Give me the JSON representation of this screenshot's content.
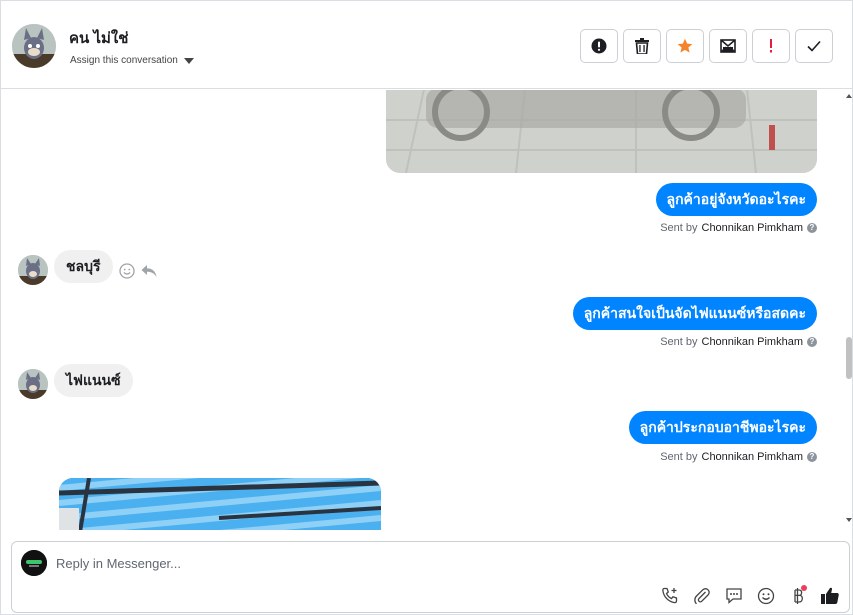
{
  "header": {
    "contact_name": "คน ไม่ใช่",
    "assign_label": "Assign this conversation",
    "actions": [
      {
        "name": "mark-spam",
        "icon": "exclamation-circle-icon"
      },
      {
        "name": "delete",
        "icon": "trash-icon"
      },
      {
        "name": "star",
        "icon": "star-icon",
        "color": "#f5832b"
      },
      {
        "name": "mark-unread",
        "icon": "envelope-icon"
      },
      {
        "name": "follow-up",
        "icon": "exclamation-icon",
        "color": "#e41e3f"
      },
      {
        "name": "mark-done",
        "icon": "check-icon"
      }
    ]
  },
  "messages": [
    {
      "direction": "out",
      "type": "image"
    },
    {
      "direction": "out",
      "text": "ลูกค้าอยู่จังหวัดอะไรคะ",
      "sent_by_prefix": "Sent by",
      "sender": "Chonnikan Pimkham"
    },
    {
      "direction": "in",
      "text": "ชลบุรี"
    },
    {
      "direction": "out",
      "text": "ลูกค้าสนใจเป็นจัดไฟแนนซ์หรือสดคะ",
      "sent_by_prefix": "Sent by",
      "sender": "Chonnikan Pimkham"
    },
    {
      "direction": "in",
      "text": "ไฟแนนซ์"
    },
    {
      "direction": "out",
      "text": "ลูกค้าประกอบอาชีพอะไรคะ",
      "sent_by_prefix": "Sent by",
      "sender": "Chonnikan Pimkham"
    },
    {
      "direction": "in",
      "type": "image"
    }
  ],
  "composer": {
    "placeholder": "Reply in Messenger...",
    "tools": [
      "phone-plus-icon",
      "paperclip-icon",
      "chat-bubble-icon",
      "smiley-icon",
      "baht-icon",
      "thumbs-up-icon"
    ]
  },
  "colors": {
    "outgoing_bubble": "#0084ff",
    "incoming_bubble": "#f0f0f0",
    "star": "#f5832b",
    "alert": "#e41e3f"
  }
}
